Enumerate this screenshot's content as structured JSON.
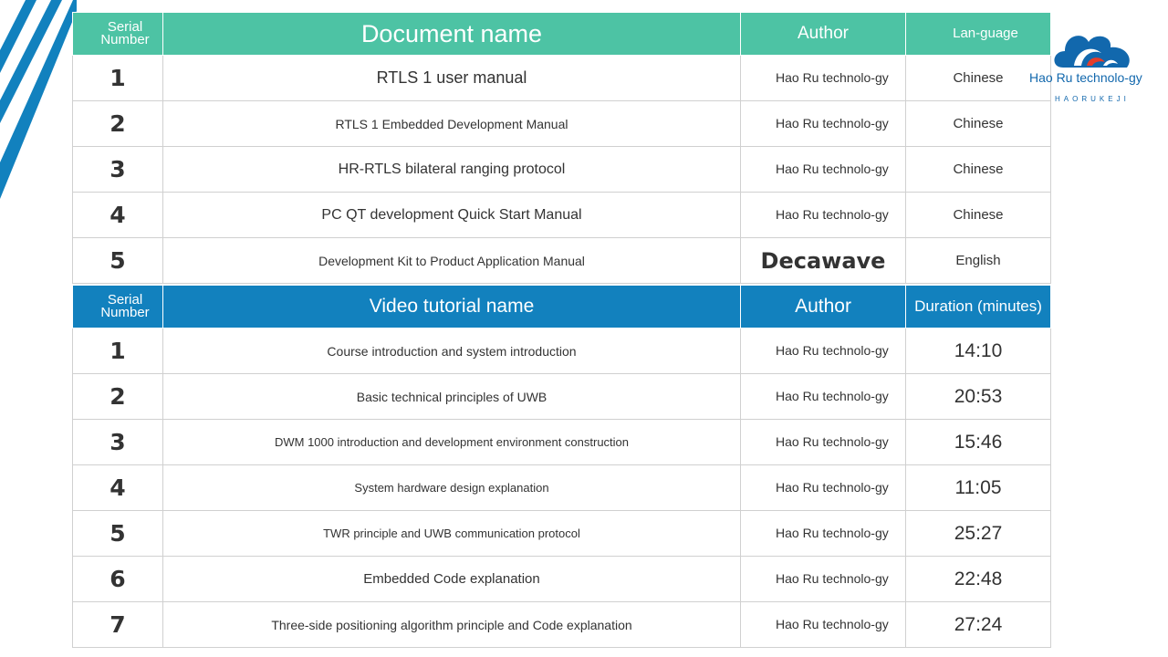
{
  "colors": {
    "docs_header_bg": "#4dc3a4",
    "video_header_bg": "#1281be",
    "stripe": "#1281be",
    "logo_blue": "#1268ad",
    "logo_red": "#e53d2a"
  },
  "logo": {
    "text": "Hao Ru technolo-gy",
    "sub": "HAORUKEJI",
    "icon": "cloud-logo-icon"
  },
  "documents": {
    "headers": {
      "serial": "Serial Number",
      "name": "Document name",
      "author": "Author",
      "language": "Lan-guage"
    },
    "rows": [
      {
        "serial": "1",
        "name": "RTLS 1 user manual",
        "author": "Hao Ru technolo-gy",
        "language": "Chinese"
      },
      {
        "serial": "2",
        "name": "RTLS 1 Embedded Development Manual",
        "author": "Hao Ru technolo-gy",
        "language": "Chinese"
      },
      {
        "serial": "3",
        "name": "HR-RTLS bilateral ranging protocol",
        "author": "Hao Ru technolo-gy",
        "language": "Chinese"
      },
      {
        "serial": "4",
        "name": "PC QT development Quick Start Manual",
        "author": "Hao Ru technolo-gy",
        "language": "Chinese"
      },
      {
        "serial": "5",
        "name": "Development Kit to Product Application Manual",
        "author": "Decawave",
        "language": "English"
      }
    ]
  },
  "videos": {
    "headers": {
      "serial": "Serial Number",
      "name": "Video tutorial name",
      "author": "Author",
      "duration": "Duration (minutes)"
    },
    "rows": [
      {
        "serial": "1",
        "name": "Course introduction and system introduction",
        "author": "Hao Ru technolo-gy",
        "duration": "14:10"
      },
      {
        "serial": "2",
        "name": "Basic technical principles of UWB",
        "author": "Hao Ru technolo-gy",
        "duration": "20:53"
      },
      {
        "serial": "3",
        "name": "DWM 1000 introduction and development environment construction",
        "author": "Hao Ru technolo-gy",
        "duration": "15:46"
      },
      {
        "serial": "4",
        "name": "System hardware design explanation",
        "author": "Hao Ru technolo-gy",
        "duration": "11:05"
      },
      {
        "serial": "5",
        "name": "TWR principle and UWB communication protocol",
        "author": "Hao Ru technolo-gy",
        "duration": "25:27"
      },
      {
        "serial": "6",
        "name": "Embedded Code explanation",
        "author": "Hao Ru technolo-gy",
        "duration": "22:48"
      },
      {
        "serial": "7",
        "name": "Three-side positioning algorithm principle and Code explanation",
        "author": "Hao Ru technolo-gy",
        "duration": "27:24"
      }
    ]
  }
}
